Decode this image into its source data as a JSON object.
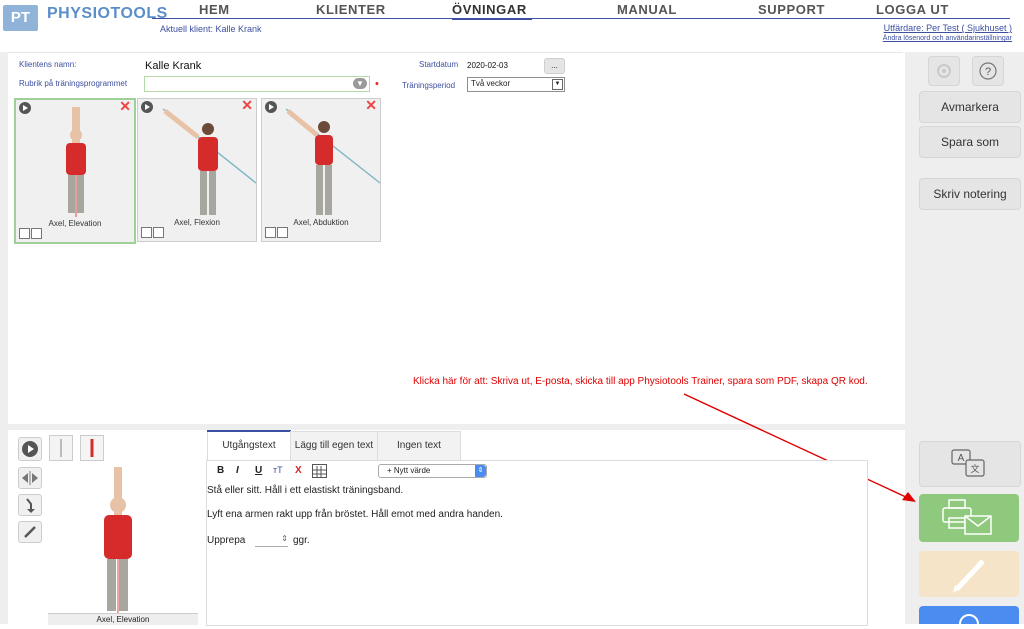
{
  "header": {
    "logo_mark": "PT",
    "brand": "PHYSIOTOOLS",
    "nav": [
      "HEM",
      "KLIENTER",
      "ÖVNINGAR",
      "MANUAL",
      "SUPPORT",
      "LOGGA UT"
    ],
    "active_nav": "ÖVNINGAR",
    "current_client": "Aktuell klient: Kalle Krank",
    "issuer": "Utfärdare: Per Test ( Sjukhuset )",
    "account_link": "Ändra lösenord och användarinställningar"
  },
  "form": {
    "client_name_label": "Klientens namn:",
    "client_name": "Kalle  Krank",
    "program_title_label": "Rubrik på träningsprogrammet",
    "program_title_value": "",
    "start_date_label": "Startdatum",
    "start_date": "2020-02-03",
    "date_button": "...",
    "period_label": "Träningsperiod",
    "period_value": "Två veckor",
    "required_marker": "•"
  },
  "exercises": [
    {
      "name": "Axel, Elevation",
      "selected": true
    },
    {
      "name": "Axel, Flexion",
      "selected": false
    },
    {
      "name": "Axel, Abduktion",
      "selected": false
    }
  ],
  "sidebar": {
    "buttons": [
      "Avmarkera",
      "Spara som",
      "Skriv notering"
    ],
    "icons": [
      "gear-icon",
      "help-icon",
      "translate-icon",
      "print-email-icon",
      "edit-icon",
      "search-icon"
    ],
    "colors": {
      "print_email": "#8ec97e",
      "edit": "#f6e4c8",
      "search": "#4a8cf0"
    }
  },
  "detail": {
    "preview_name": "Axel, Elevation",
    "tabs": [
      "Utgångstext",
      "Lägg till egen text",
      "Ingen text"
    ],
    "active_tab": "Utgångstext",
    "toolbar": {
      "bold": "B",
      "italic": "I",
      "underline": "U",
      "font_size": "тT",
      "clear": "X",
      "value_select": "+ Nytt värde"
    },
    "text_lines": [
      "Stå eller sitt. Håll i ett elastiskt träningsband.",
      "Lyft ena armen rakt upp från bröstet. Håll emot med andra handen."
    ],
    "repeat_before": "Upprepa",
    "repeat_after": "ggr."
  },
  "annotation": "Klicka här för att: Skriva ut, E-posta, skicka till app Physiotools Trainer, spara som PDF, skapa QR kod."
}
